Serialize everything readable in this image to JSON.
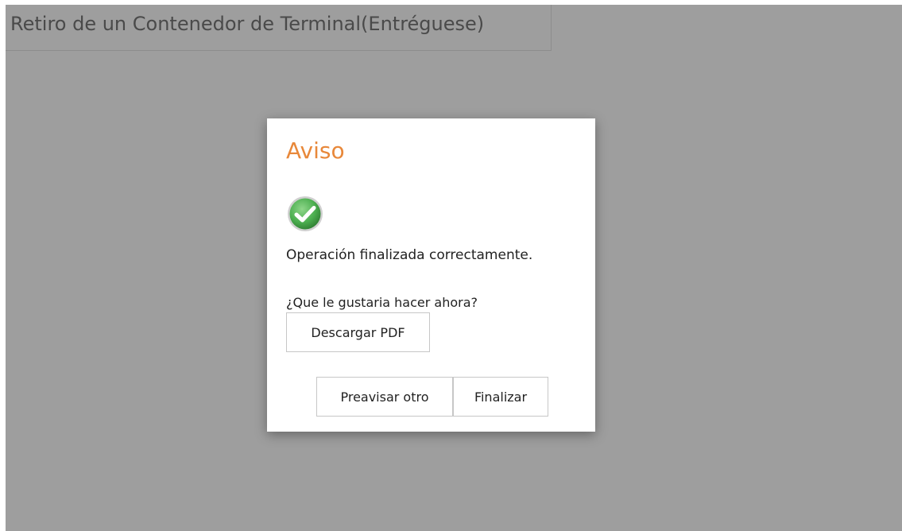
{
  "page": {
    "title": "Retiro de un Contenedor de Terminal(Entréguese)"
  },
  "dialog": {
    "title": "Aviso",
    "icon": "check-circle-icon",
    "message": "Operación finalizada correctamente.",
    "question": "¿Que le gustaria hacer ahora?",
    "download_pdf_label": "Descargar PDF",
    "preavisar_label": "Preavisar otro",
    "finalizar_label": "Finalizar"
  },
  "colors": {
    "title_accent": "#e8883a",
    "overlay": "#9e9e9e",
    "success_green": "#4caf50"
  }
}
